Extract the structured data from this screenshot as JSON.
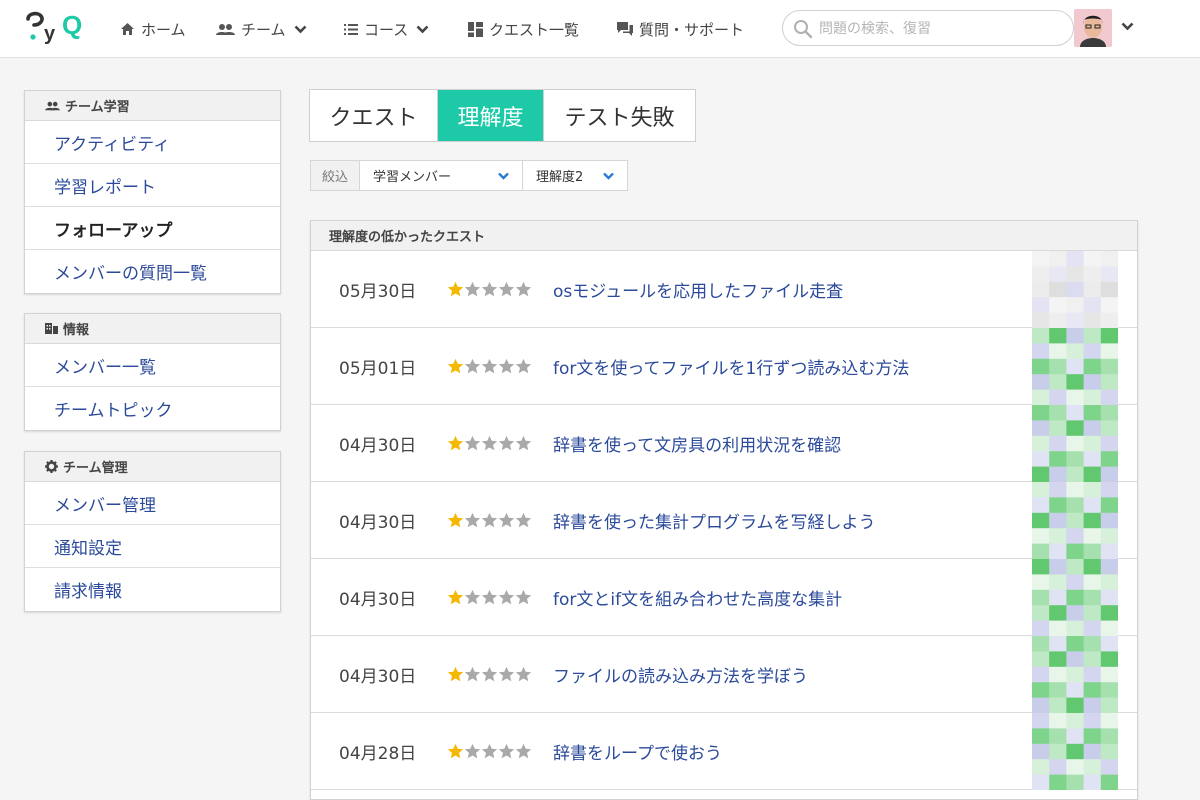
{
  "nav": {
    "logo_text": "PyQ",
    "items": [
      {
        "label": "ホーム",
        "icon": "home-icon"
      },
      {
        "label": "チーム",
        "icon": "users-icon",
        "dropdown": true
      },
      {
        "label": "コース",
        "icon": "list-icon",
        "dropdown": true
      },
      {
        "label": "クエスト一覧",
        "icon": "grid-icon"
      },
      {
        "label": "質問・サポート",
        "icon": "chat-icon"
      }
    ],
    "search_placeholder": "問題の検索、復習"
  },
  "sidebar": {
    "groups": [
      {
        "title": "チーム学習",
        "icon": "users-icon",
        "items": [
          {
            "label": "アクティビティ"
          },
          {
            "label": "学習レポート"
          },
          {
            "label": "フォローアップ",
            "active": true
          },
          {
            "label": "メンバーの質問一覧"
          }
        ]
      },
      {
        "title": "情報",
        "icon": "building-icon",
        "items": [
          {
            "label": "メンバー一覧"
          },
          {
            "label": "チームトピック"
          }
        ]
      },
      {
        "title": "チーム管理",
        "icon": "gear-icon",
        "items": [
          {
            "label": "メンバー管理"
          },
          {
            "label": "通知設定"
          },
          {
            "label": "請求情報"
          }
        ]
      }
    ]
  },
  "tabs": [
    {
      "label": "クエスト"
    },
    {
      "label": "理解度",
      "active": true
    },
    {
      "label": "テスト失敗"
    }
  ],
  "filters": {
    "label": "絞込",
    "member_select": "学習メンバー",
    "level_select": "理解度2"
  },
  "list": {
    "title": "理解度の低かったクエスト",
    "rows": [
      {
        "date": "05月30日",
        "rating": 1,
        "title": "osモジュールを応用したファイル走査"
      },
      {
        "date": "05月01日",
        "rating": 1,
        "title": "for文を使ってファイルを1行ずつ読み込む方法"
      },
      {
        "date": "04月30日",
        "rating": 1,
        "title": "辞書を使って文房具の利用状況を確認"
      },
      {
        "date": "04月30日",
        "rating": 1,
        "title": "辞書を使った集計プログラムを写経しよう"
      },
      {
        "date": "04月30日",
        "rating": 1,
        "title": "for文とif文を組み合わせた高度な集計"
      },
      {
        "date": "04月30日",
        "rating": 1,
        "title": "ファイルの読み込み方法を学ぼう"
      },
      {
        "date": "04月28日",
        "rating": 1,
        "title": "辞書をループで使おう"
      }
    ]
  },
  "colors": {
    "accent": "#1ec9a7",
    "link": "#2b4a9a",
    "star_on": "#f5b800",
    "star_off": "#a9a9a9"
  }
}
